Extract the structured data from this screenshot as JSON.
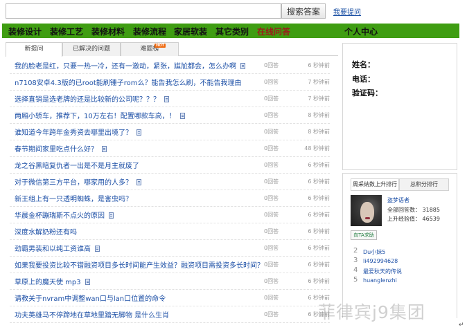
{
  "search": {
    "value": "",
    "button_label": "搜索答案",
    "ask_link": "我要提问"
  },
  "nav": {
    "items": [
      "装修设计",
      "装修工艺",
      "装修材料",
      "装修流程",
      "家居软装",
      "其它类别",
      "在线问答"
    ],
    "active": "在线问答",
    "personal_center": "个人中心"
  },
  "tabs": [
    {
      "label": "新提问",
      "active": true
    },
    {
      "label": "已解决的问题",
      "active": false
    },
    {
      "label": "难题榜",
      "active": false,
      "badge": "HOT"
    }
  ],
  "questions": [
    {
      "title": "我的脸老是红，只要一热一冷，还有一激动，紧张，尴尬都会，怎么办啊",
      "answers": "0回答",
      "time": "6 秒钟前",
      "icon": true
    },
    {
      "title": "n7108安卓4.3版的已root能刷锤子rom么？能告我怎么刷，不能告我理由",
      "answers": "0回答",
      "time": "7 秒钟前",
      "icon": false
    },
    {
      "title": "选择直销是选老牌的还是比较新的公司呢？？？",
      "answers": "0回答",
      "time": "7 秒钟前",
      "icon": true
    },
    {
      "title": "两厢小轿车，推荐下，10万左右！配置哪款车高，！",
      "answers": "0回答",
      "time": "8 秒钟前",
      "icon": true
    },
    {
      "title": "谁知道今年跨年金秀资去哪里出境了？",
      "answers": "0回答",
      "time": "8 秒钟前",
      "icon": true
    },
    {
      "title": "春节期间家里吃点什么好？",
      "answers": "0回答",
      "time": "48 秒钟前",
      "icon": true
    },
    {
      "title": "龙之谷黑暗复仇者一出是不是月主就废了",
      "answers": "0回答",
      "time": "6 秒钟前",
      "icon": false
    },
    {
      "title": "对于微信第三方平台，哪家用的人多？",
      "answers": "0回答",
      "time": "6 秒钟前",
      "icon": true
    },
    {
      "title": "新王组上有一只透明蜘蛛，是害虫吗？",
      "answers": "0回答",
      "time": "6 秒钟前",
      "icon": false
    },
    {
      "title": "华晨金杯蹦瑞斯不点火的原因",
      "answers": "0回答",
      "time": "6 秒钟前",
      "icon": true
    },
    {
      "title": "深度水解奶粉还有吗",
      "answers": "0回答",
      "time": "6 秒钟前",
      "icon": false
    },
    {
      "title": "劲霸男装和以纯工资谁高",
      "answers": "0回答",
      "time": "6 秒钟前",
      "icon": true
    },
    {
      "title": "如果我要投资比较不错融资项目多长时间能产生效益？融资项目需投资多长时间？",
      "answers": "0回答",
      "time": "6 秒钟前",
      "icon": false
    },
    {
      "title": "草原上的魔天使 mp3",
      "answers": "0回答",
      "time": "6 秒钟前",
      "icon": true
    },
    {
      "title": "请教关于nvram中调整wan口与lan口位置的命令",
      "answers": "0回答",
      "time": "6 秒钟前",
      "icon": false
    },
    {
      "title": "功夫英雄马不停蹄地在草地里踏无脚物 是什么生肖",
      "answers": "0回答",
      "time": "6 秒钟前",
      "icon": false
    }
  ],
  "user_info": {
    "name_label": "姓名：",
    "phone_label": "电话：",
    "code_label": "验证码："
  },
  "ranking": {
    "tabs": [
      {
        "label": "周采纳数上升排行",
        "active": true
      },
      {
        "label": "总积分排行",
        "active": false
      }
    ],
    "top_user": {
      "name": "盗梦语者",
      "total_answers": "全部回答数： 31885",
      "monthly_points": "上升经验值： 46539"
    },
    "help_button": "向TA求助",
    "list": [
      {
        "rank": "2",
        "name": "Du小妹5"
      },
      {
        "rank": "3",
        "name": "li492994628"
      },
      {
        "rank": "4",
        "name": "最爱秋天的传说"
      },
      {
        "rank": "5",
        "name": "huanglenzhi"
      }
    ]
  },
  "watermark": "菲律宾j9集团",
  "return_mark": "↵"
}
